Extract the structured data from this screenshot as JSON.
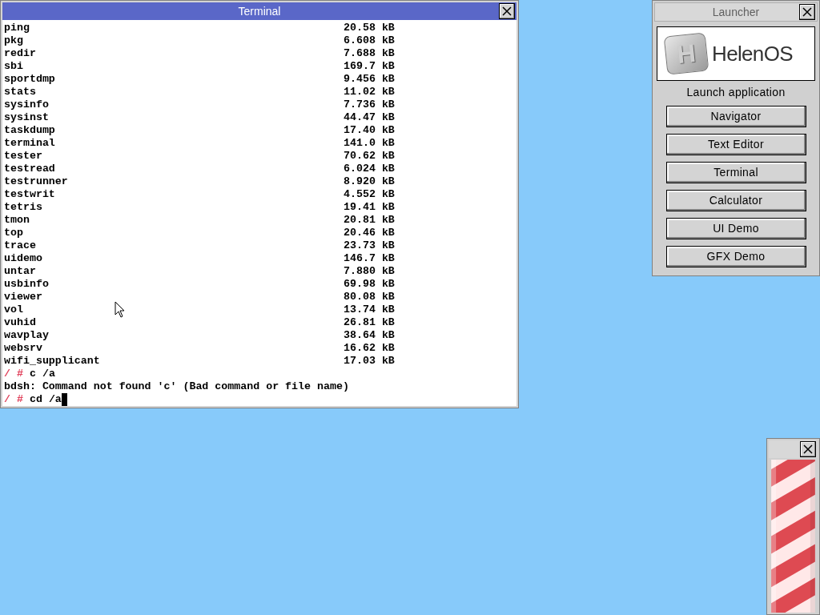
{
  "terminal": {
    "title": "Terminal",
    "lines": [
      {
        "kind": "file",
        "name": "ping",
        "size": "20.58 kB"
      },
      {
        "kind": "file",
        "name": "pkg",
        "size": "6.608 kB"
      },
      {
        "kind": "file",
        "name": "redir",
        "size": "7.688 kB"
      },
      {
        "kind": "file",
        "name": "sbi",
        "size": "169.7 kB"
      },
      {
        "kind": "file",
        "name": "sportdmp",
        "size": "9.456 kB"
      },
      {
        "kind": "file",
        "name": "stats",
        "size": "11.02 kB"
      },
      {
        "kind": "file",
        "name": "sysinfo",
        "size": "7.736 kB"
      },
      {
        "kind": "file",
        "name": "sysinst",
        "size": "44.47 kB"
      },
      {
        "kind": "file",
        "name": "taskdump",
        "size": "17.40 kB"
      },
      {
        "kind": "file",
        "name": "terminal",
        "size": "141.0 kB"
      },
      {
        "kind": "file",
        "name": "tester",
        "size": "70.62 kB"
      },
      {
        "kind": "file",
        "name": "testread",
        "size": "6.024 kB"
      },
      {
        "kind": "file",
        "name": "testrunner",
        "size": "8.920 kB"
      },
      {
        "kind": "file",
        "name": "testwrit",
        "size": "4.552 kB"
      },
      {
        "kind": "file",
        "name": "tetris",
        "size": "19.41 kB"
      },
      {
        "kind": "file",
        "name": "tmon",
        "size": "20.81 kB"
      },
      {
        "kind": "file",
        "name": "top",
        "size": "20.46 kB"
      },
      {
        "kind": "file",
        "name": "trace",
        "size": "23.73 kB"
      },
      {
        "kind": "file",
        "name": "uidemo",
        "size": "146.7 kB"
      },
      {
        "kind": "file",
        "name": "untar",
        "size": "7.880 kB"
      },
      {
        "kind": "file",
        "name": "usbinfo",
        "size": "69.98 kB"
      },
      {
        "kind": "file",
        "name": "viewer",
        "size": "80.08 kB"
      },
      {
        "kind": "file",
        "name": "vol",
        "size": "13.74 kB"
      },
      {
        "kind": "file",
        "name": "vuhid",
        "size": "26.81 kB"
      },
      {
        "kind": "file",
        "name": "wavplay",
        "size": "38.64 kB"
      },
      {
        "kind": "file",
        "name": "websrv",
        "size": "16.62 kB"
      },
      {
        "kind": "file",
        "name": "wifi_supplicant",
        "size": "17.03 kB"
      },
      {
        "kind": "prompt",
        "prompt": "/ #",
        "command": "c /a",
        "cursor": false
      },
      {
        "kind": "output",
        "text": "bdsh: Command not found 'c' (Bad command or file name)"
      },
      {
        "kind": "prompt",
        "prompt": "/ #",
        "command": "cd /a",
        "cursor": true
      }
    ]
  },
  "launcher": {
    "title": "Launcher",
    "logo_text": "HelenOS",
    "logo_letter": "H",
    "heading": "Launch application",
    "buttons": [
      "Navigator",
      "Text Editor",
      "Terminal",
      "Calculator",
      "UI Demo",
      "GFX Demo"
    ]
  }
}
